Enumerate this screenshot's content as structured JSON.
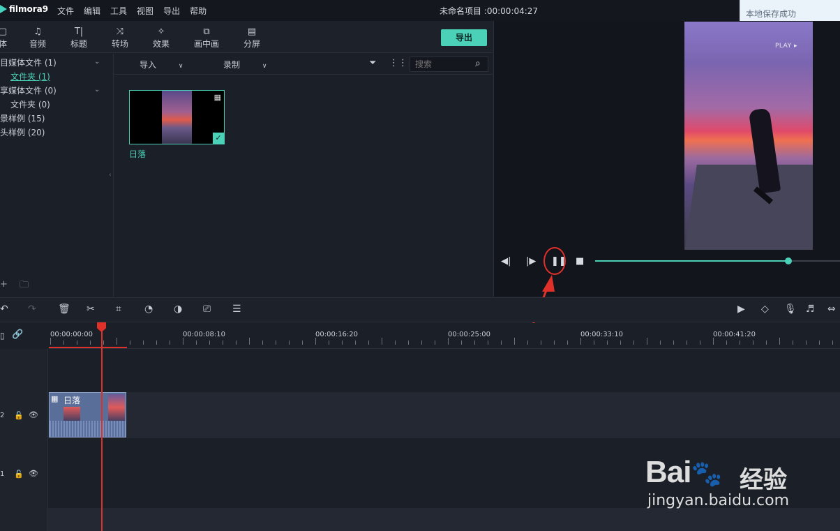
{
  "app": {
    "name": "filmora9",
    "menu": [
      "文件",
      "编辑",
      "工具",
      "视图",
      "导出",
      "帮助"
    ],
    "project_title": "未命名项目 :00:00:04:27",
    "toast": "本地保存成功"
  },
  "media_tabs": [
    {
      "label": "体",
      "icon": "media-icon"
    },
    {
      "label": "音频",
      "icon": "music-icon"
    },
    {
      "label": "标题",
      "icon": "title-icon"
    },
    {
      "label": "转场",
      "icon": "transition-icon"
    },
    {
      "label": "效果",
      "icon": "effects-icon"
    },
    {
      "label": "画中画",
      "icon": "pip-icon"
    },
    {
      "label": "分屏",
      "icon": "split-screen-icon"
    }
  ],
  "export_label": "导出",
  "library": {
    "items": [
      {
        "label": "目媒体文件 (1)"
      },
      {
        "label": "文件夹 (1)"
      },
      {
        "label": "享媒体文件 (0)"
      },
      {
        "label": "文件夹 (0)"
      },
      {
        "label": "景样例 (15)"
      },
      {
        "label": "头样例 (20)"
      }
    ]
  },
  "media_toolbar": {
    "import_label": "导入",
    "record_label": "录制",
    "search_placeholder": "搜索"
  },
  "media_item": {
    "label": "日落"
  },
  "preview": {
    "overlay_text": "PLAY ▸",
    "progress": 0.79
  },
  "timeline": {
    "timecodes": [
      "00:00:00:00",
      "00:00:08:10",
      "00:00:16:20",
      "00:00:25:00",
      "00:00:33:10",
      "00:00:41:20"
    ],
    "tracks": [
      {
        "number": "2"
      },
      {
        "number": "1"
      }
    ],
    "clip_label": "日落"
  },
  "watermark": {
    "brand": "Bai",
    "brand_suffix": "经验",
    "url": "jingyan.baidu.com"
  },
  "colors": {
    "accent": "#4cd1b9",
    "playhead": "#e0302a",
    "annotation": "#e0302a"
  }
}
